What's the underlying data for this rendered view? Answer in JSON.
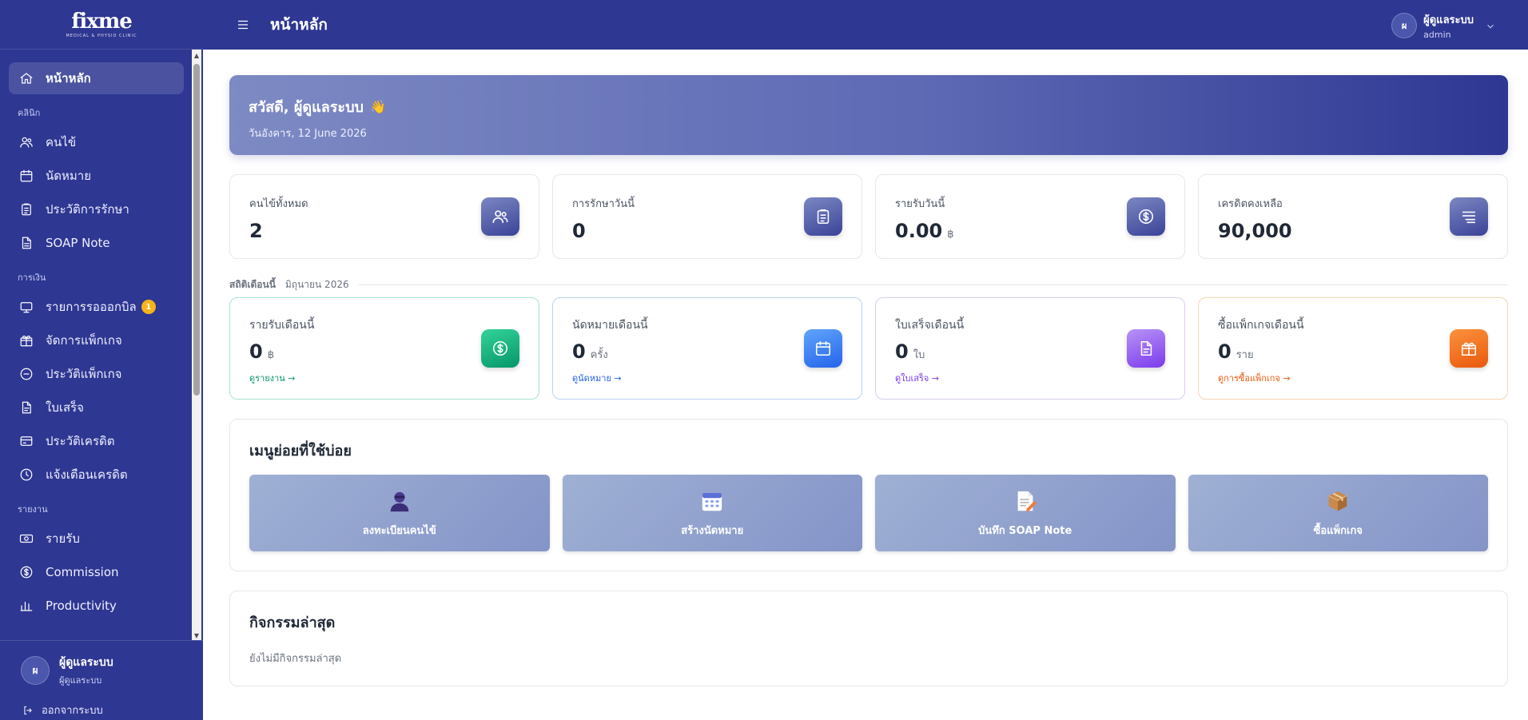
{
  "brand": {
    "logo": "fixme",
    "tagline": "MEDICAL & PHYSIO CLINIC"
  },
  "topbar": {
    "title": "หน้าหลัก",
    "user_name": "ผู้ดูแลระบบ",
    "user_role": "admin",
    "avatar_initial": "ผ"
  },
  "sidebar": {
    "home": "หน้าหลัก",
    "sections": {
      "clinic": "คลินิก",
      "finance": "การเงิน",
      "report": "รายงาน"
    },
    "clinic_items": [
      "คนไข้",
      "นัดหมาย",
      "ประวัติการรักษา",
      "SOAP Note"
    ],
    "finance_items": [
      "รายการรอออกบิล",
      "จัดการแพ็กเกจ",
      "ประวัติแพ็กเกจ",
      "ใบเสร็จ",
      "ประวัติเครดิต",
      "แจ้งเตือนเครดิต"
    ],
    "pending_badge": "1",
    "report_items": [
      "รายรับ",
      "Commission",
      "Productivity"
    ],
    "footer": {
      "user_name": "ผู้ดูแลระบบ",
      "user_role": "ผู้ดูแลระบบ",
      "avatar_initial": "ผ",
      "logout": "ออกจากระบบ"
    }
  },
  "hero": {
    "greeting": "สวัสดี, ผู้ดูแลระบบ",
    "wave": "👋",
    "date": "วันอังคาร, 12 June 2026"
  },
  "stats": [
    {
      "label": "คนไข้ทั้งหมด",
      "value": "2",
      "unit": "",
      "icon": "users-icon"
    },
    {
      "label": "การรักษาวันนี้",
      "value": "0",
      "unit": "",
      "icon": "clipboard-icon"
    },
    {
      "label": "รายรับวันนี้",
      "value": "0.00",
      "unit": "฿",
      "icon": "dollar-icon"
    },
    {
      "label": "เครดิตคงเหลือ",
      "value": "90,000",
      "unit": "",
      "icon": "credit-icon"
    }
  ],
  "month_header": {
    "label": "สถิติเดือนนี้",
    "period": "มิถุนายน 2026"
  },
  "month_stats": [
    {
      "label": "รายรับเดือนนี้",
      "value": "0",
      "unit": "฿",
      "link": "ดูรายงาน →",
      "color": "#059669"
    },
    {
      "label": "นัดหมายเดือนนี้",
      "value": "0",
      "unit": "ครั้ง",
      "link": "ดูนัดหมาย →",
      "color": "#2563eb"
    },
    {
      "label": "ใบเสร็จเดือนนี้",
      "value": "0",
      "unit": "ใบ",
      "link": "ดูใบเสร็จ →",
      "color": "#7c3aed"
    },
    {
      "label": "ซื้อแพ็กเกจเดือนนี้",
      "value": "0",
      "unit": "ราย",
      "link": "ดูการซื้อแพ็กเกจ →",
      "color": "#ea580c"
    }
  ],
  "quick_menu": {
    "title": "เมนูย่อยที่ใช้บ่อย",
    "items": [
      {
        "label": "ลงทะเบียนคนไข้",
        "icon": "person-icon"
      },
      {
        "label": "สร้างนัดหมาย",
        "icon": "calendar-icon"
      },
      {
        "label": "บันทึก SOAP Note",
        "icon": "memo-icon"
      },
      {
        "label": "ซื้อแพ็กเกจ",
        "icon": "package-icon"
      }
    ]
  },
  "activity": {
    "title": "กิจกรรมล่าสุด",
    "empty": "ยังไม่มีกิจกรรมล่าสุด"
  },
  "colors": {
    "primary": "#2e3792",
    "badge": "#f6b31a"
  }
}
